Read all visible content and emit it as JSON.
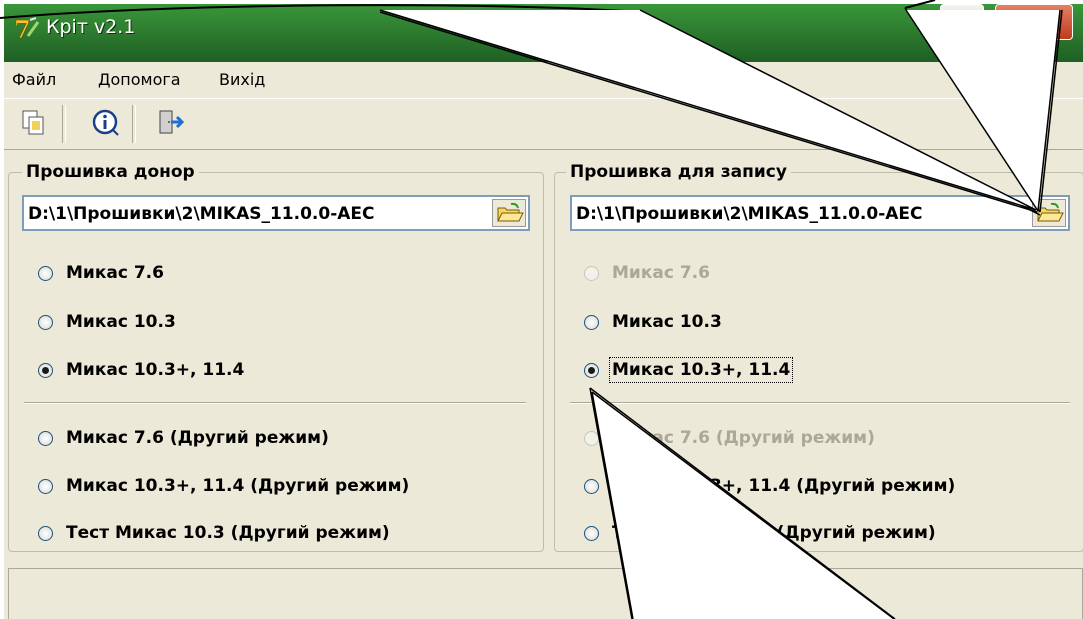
{
  "window": {
    "title": "Кріт v2.1",
    "accent_color": "#2b7a2e",
    "close_color": "#d24a2c"
  },
  "menu": {
    "items": [
      {
        "label": "Файл"
      },
      {
        "label": "Допомога"
      },
      {
        "label": "Вихід"
      }
    ]
  },
  "toolbar": {
    "icons": [
      "copy-document-icon",
      "info-icon",
      "exit-door-icon"
    ]
  },
  "donor": {
    "label": "Прошивка донор",
    "path": "D:\\1\\Прошивки\\2\\MIKAS_11.0.0-AEC",
    "options": [
      {
        "label": "Микас 7.6",
        "checked": false,
        "disabled": false
      },
      {
        "label": "Микас 10.3",
        "checked": false,
        "disabled": false
      },
      {
        "label": "Микас 10.3+, 11.4",
        "checked": true,
        "disabled": false
      },
      {
        "label": "Микас 7.6 (Другий режим)",
        "checked": false,
        "disabled": false
      },
      {
        "label": "Микас 10.3+, 11.4 (Другий режим)",
        "checked": false,
        "disabled": false
      },
      {
        "label": "Тест Микас 10.3 (Другий режим)",
        "checked": false,
        "disabled": false
      }
    ]
  },
  "target": {
    "label": "Прошивка для запису",
    "path": "D:\\1\\Прошивки\\2\\MIKAS_11.0.0-AEC",
    "options": [
      {
        "label": "Микас 7.6",
        "checked": false,
        "disabled": true
      },
      {
        "label": "Микас 10.3",
        "checked": false,
        "disabled": false
      },
      {
        "label": "Микас 10.3+, 11.4",
        "checked": true,
        "disabled": false,
        "focused": true
      },
      {
        "label": "Микас 7.6 (Другий режим)",
        "checked": false,
        "disabled": true
      },
      {
        "label": "Микас 10.3+, 11.4 (Другий режим)",
        "checked": false,
        "disabled": false
      },
      {
        "label": "Тест Микас 10.3 (Другий режим)",
        "checked": false,
        "disabled": false
      }
    ]
  }
}
